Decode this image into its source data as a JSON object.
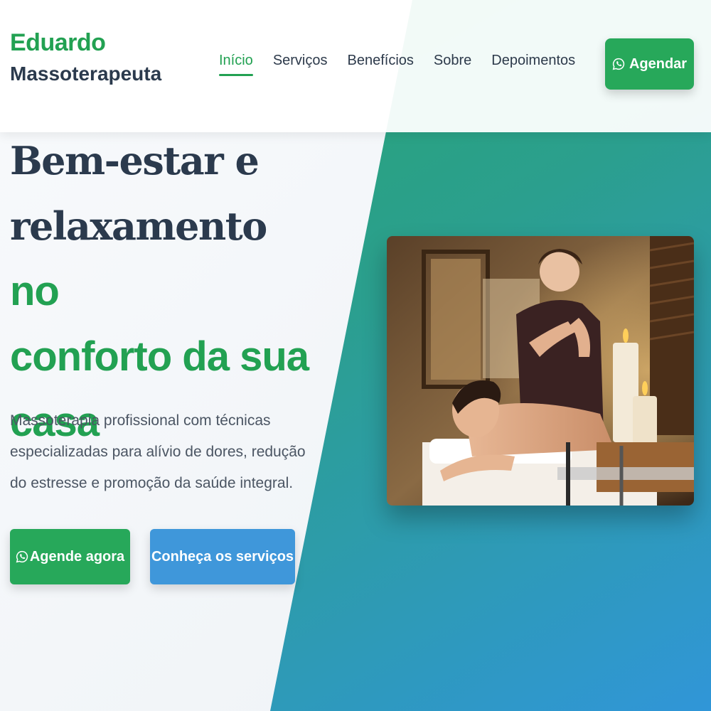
{
  "brand": {
    "name": "Eduardo",
    "title": "Massoterapeuta"
  },
  "nav": {
    "items": [
      {
        "label": "Início",
        "active": true
      },
      {
        "label": "Serviços",
        "active": false
      },
      {
        "label": "Benefícios",
        "active": false
      },
      {
        "label": "Sobre",
        "active": false
      },
      {
        "label": "Depoimentos",
        "active": false
      }
    ],
    "cta_label": "Agendar",
    "cta_icon": "whatsapp-icon"
  },
  "hero": {
    "title_line1": "Bem-estar e",
    "title_line2": "relaxamento ",
    "title_accent_inline": "no",
    "title_accent_line3": "conforto da sua",
    "title_accent_line4": "casa",
    "description": "Massoterapia profissional com técnicas especializadas para alívio de dores, redução do estresse e promoção da saúde integral.",
    "primary_button": "Agende agora",
    "primary_icon": "whatsapp-icon",
    "secondary_button": "Conheça os serviços",
    "image_subject": "massage-photo"
  },
  "colors": {
    "brand_green": "#22a152",
    "button_green": "#27a85a",
    "button_blue": "#3f97da",
    "text_dark": "#2b3a4d",
    "gradient_start": "#27a86a",
    "gradient_end": "#3096d8"
  }
}
